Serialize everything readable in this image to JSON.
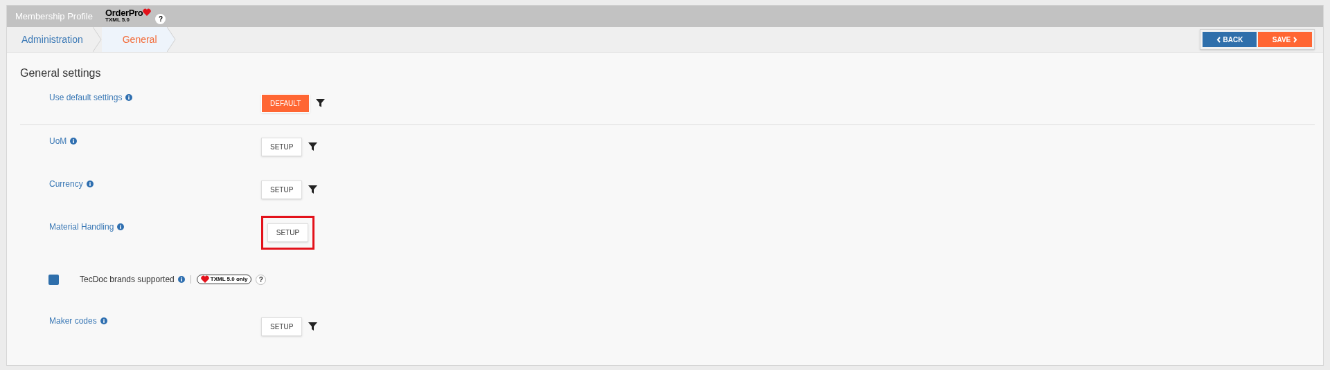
{
  "header": {
    "title": "Membership Profile",
    "logo_name": "OrderPro",
    "logo_version": "TXML 5.0",
    "help": "?"
  },
  "breadcrumb": [
    {
      "label": "Administration",
      "selected": false
    },
    {
      "label": "General",
      "selected": true
    }
  ],
  "actions": [
    {
      "label": "BACK",
      "kind": "back"
    },
    {
      "label": "SAVE",
      "kind": "save"
    }
  ],
  "section": {
    "title": "General settings"
  },
  "rows": [
    {
      "kind": "button",
      "label": "Use default settings",
      "button": "DEFAULT",
      "primary": true,
      "filter": true,
      "highlighted": false,
      "divider_after": true
    },
    {
      "kind": "button",
      "label": "UoM",
      "button": "SETUP",
      "primary": false,
      "filter": true,
      "highlighted": false,
      "divider_after": false
    },
    {
      "kind": "button",
      "label": "Currency",
      "button": "SETUP",
      "primary": false,
      "filter": true,
      "highlighted": false,
      "divider_after": false
    },
    {
      "kind": "button",
      "label": "Material Handling",
      "button": "SETUP",
      "primary": false,
      "filter": false,
      "highlighted": true,
      "divider_after": false
    },
    {
      "kind": "checkbox",
      "label": "TecDoc brands supported",
      "checked": true,
      "badge": "TXML 5.0 only",
      "help": "?"
    },
    {
      "kind": "button",
      "label": "Maker codes",
      "button": "SETUP",
      "primary": false,
      "filter": true,
      "highlighted": false,
      "divider_after": false
    }
  ]
}
